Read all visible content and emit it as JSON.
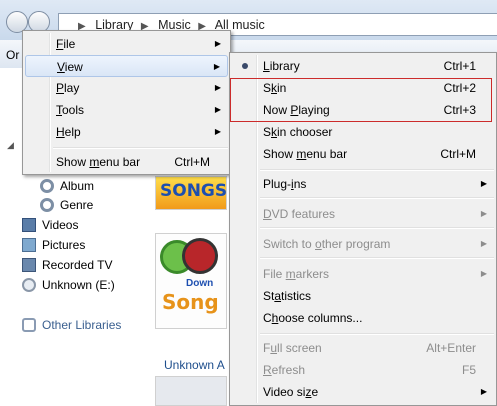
{
  "address": {
    "crumbs": [
      "Library",
      "Music",
      "All music"
    ]
  },
  "toolbar": {
    "organize_label": "Or"
  },
  "sidebar": {
    "items": [
      {
        "label": "Album",
        "icon": "album-icon"
      },
      {
        "label": "Genre",
        "icon": "genre-icon"
      },
      {
        "label": "Videos",
        "icon": "videos-icon"
      },
      {
        "label": "Pictures",
        "icon": "pictures-icon"
      },
      {
        "label": "Recorded TV",
        "icon": "recorded-tv-icon"
      },
      {
        "label": "Unknown (E:)",
        "icon": "disc-icon"
      },
      {
        "label": "Other Libraries",
        "icon": "other-libraries-icon"
      }
    ]
  },
  "content": {
    "album1_caption": "SONGS.",
    "album2_caption": "Song",
    "album2_top": "Down",
    "unknown_label": "Unknown A"
  },
  "main_menu": {
    "items": [
      {
        "pre": "",
        "key": "F",
        "post": "ile",
        "has_submenu": true
      },
      {
        "pre": "",
        "key": "V",
        "post": "iew",
        "has_submenu": true
      },
      {
        "pre": "",
        "key": "P",
        "post": "lay",
        "has_submenu": true
      },
      {
        "pre": "",
        "key": "T",
        "post": "ools",
        "has_submenu": true
      },
      {
        "pre": "",
        "key": "H",
        "post": "elp",
        "has_submenu": true
      },
      {
        "pre": "Show ",
        "key": "m",
        "post": "enu bar",
        "shortcut": "Ctrl+M"
      }
    ]
  },
  "view_menu": {
    "items": [
      {
        "pre": "",
        "key": "L",
        "post": "ibrary",
        "shortcut": "Ctrl+1",
        "selected": true
      },
      {
        "pre": "S",
        "key": "k",
        "post": "in",
        "shortcut": "Ctrl+2"
      },
      {
        "pre": "Now ",
        "key": "P",
        "post": "laying",
        "shortcut": "Ctrl+3"
      },
      {
        "pre": "S",
        "key": "k",
        "post": "in chooser"
      },
      {
        "pre": "Show ",
        "key": "m",
        "post": "enu bar",
        "shortcut": "Ctrl+M"
      },
      {
        "pre": "Plug-",
        "key": "i",
        "post": "ns",
        "has_submenu": true
      },
      {
        "pre": "",
        "key": "D",
        "post": "VD features",
        "has_submenu": true,
        "disabled": true
      },
      {
        "pre": "Switch to ",
        "key": "o",
        "post": "ther program",
        "has_submenu": true,
        "disabled": true
      },
      {
        "pre": "File ",
        "key": "m",
        "post": "arkers",
        "has_submenu": true,
        "disabled": true
      },
      {
        "pre": "St",
        "key": "a",
        "post": "tistics"
      },
      {
        "pre": "C",
        "key": "h",
        "post": "oose columns..."
      },
      {
        "pre": "F",
        "key": "u",
        "post": "ll screen",
        "shortcut": "Alt+Enter",
        "disabled": true
      },
      {
        "pre": "",
        "key": "R",
        "post": "efresh",
        "shortcut": "F5",
        "disabled": true
      },
      {
        "pre": "Video si",
        "key": "z",
        "post": "e",
        "has_submenu": true
      }
    ]
  },
  "colors": {
    "highlight_box": "#cc2b2b",
    "menu_bg": "#f0f0f0",
    "link_blue": "#1e4e8c"
  }
}
